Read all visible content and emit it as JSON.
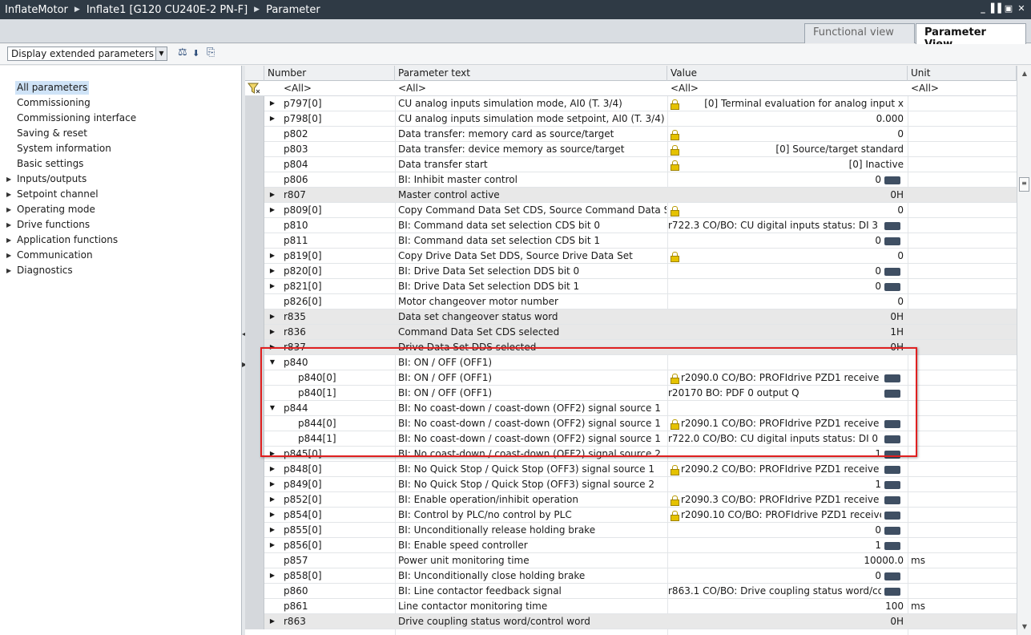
{
  "titlebar": {
    "crumbs": [
      "InflateMotor",
      "Inflate1 [G120 CU240E-2 PN-F]",
      "Parameter"
    ]
  },
  "tabs": {
    "functional": "Functional view",
    "parameter": "Parameter View"
  },
  "toolbar": {
    "filter_select": "Display extended parameters"
  },
  "nav": {
    "items": [
      {
        "label": "All parameters",
        "expandable": false
      },
      {
        "label": "Commissioning",
        "expandable": false
      },
      {
        "label": "Commissioning interface",
        "expandable": false
      },
      {
        "label": "Saving & reset",
        "expandable": false
      },
      {
        "label": "System information",
        "expandable": false
      },
      {
        "label": "Basic settings",
        "expandable": false
      },
      {
        "label": "Inputs/outputs",
        "expandable": true
      },
      {
        "label": "Setpoint channel",
        "expandable": true
      },
      {
        "label": "Operating mode",
        "expandable": true
      },
      {
        "label": "Drive functions",
        "expandable": true
      },
      {
        "label": "Application functions",
        "expandable": true
      },
      {
        "label": "Communication",
        "expandable": true
      },
      {
        "label": "Diagnostics",
        "expandable": true
      }
    ]
  },
  "grid": {
    "columns": {
      "number": "Number",
      "text": "Parameter text",
      "value": "Value",
      "unit": "Unit"
    },
    "filter": {
      "number": "<All>",
      "text": "<All>",
      "value": "<All>",
      "unit": "<All>"
    },
    "rows": [
      {
        "exp": "right",
        "num": "p797[0]",
        "text": "CU analog inputs simulation mode, AI0 (T. 3/4)",
        "lock": true,
        "val": "[0] Terminal evaluation for analog input x",
        "bi": false,
        "unit": "",
        "shaded": false,
        "child": false
      },
      {
        "exp": "right",
        "num": "p798[0]",
        "text": "CU analog inputs simulation mode setpoint, AI0 (T. 3/4)",
        "lock": false,
        "val": "0.000",
        "bi": false,
        "unit": "",
        "shaded": false,
        "child": false
      },
      {
        "exp": "",
        "num": "p802",
        "text": "Data transfer: memory card as source/target",
        "lock": true,
        "val": "0",
        "bi": false,
        "unit": "",
        "shaded": false,
        "child": false
      },
      {
        "exp": "",
        "num": "p803",
        "text": "Data transfer: device memory as source/target",
        "lock": true,
        "val": "[0] Source/target standard",
        "bi": false,
        "unit": "",
        "shaded": false,
        "child": false
      },
      {
        "exp": "",
        "num": "p804",
        "text": "Data transfer start",
        "lock": true,
        "val": "[0] Inactive",
        "bi": false,
        "unit": "",
        "shaded": false,
        "child": false
      },
      {
        "exp": "",
        "num": "p806",
        "text": "BI: Inhibit master control",
        "lock": false,
        "val": "0",
        "bi": true,
        "unit": "",
        "shaded": false,
        "child": false
      },
      {
        "exp": "right",
        "num": "r807",
        "text": "Master control active",
        "lock": false,
        "val": "0H",
        "bi": false,
        "unit": "",
        "shaded": true,
        "child": false
      },
      {
        "exp": "right",
        "num": "p809[0]",
        "text": "Copy Command Data Set CDS, Source Command Data Set",
        "lock": true,
        "val": "0",
        "bi": false,
        "unit": "",
        "shaded": false,
        "child": false
      },
      {
        "exp": "",
        "num": "p810",
        "text": "BI: Command data set selection CDS bit 0",
        "lock": false,
        "val": "r722.3 CO/BO: CU digital inputs status: DI 3 (T. 8)",
        "bi": true,
        "unit": "",
        "shaded": false,
        "child": false
      },
      {
        "exp": "",
        "num": "p811",
        "text": "BI: Command data set selection CDS bit 1",
        "lock": false,
        "val": "0",
        "bi": true,
        "unit": "",
        "shaded": false,
        "child": false
      },
      {
        "exp": "right",
        "num": "p819[0]",
        "text": "Copy Drive Data Set DDS, Source Drive Data Set",
        "lock": true,
        "val": "0",
        "bi": false,
        "unit": "",
        "shaded": false,
        "child": false
      },
      {
        "exp": "right",
        "num": "p820[0]",
        "text": "BI: Drive Data Set selection DDS bit 0",
        "lock": false,
        "val": "0",
        "bi": true,
        "unit": "",
        "shaded": false,
        "child": false
      },
      {
        "exp": "right",
        "num": "p821[0]",
        "text": "BI: Drive Data Set selection DDS bit 1",
        "lock": false,
        "val": "0",
        "bi": true,
        "unit": "",
        "shaded": false,
        "child": false
      },
      {
        "exp": "",
        "num": "p826[0]",
        "text": "Motor changeover motor number",
        "lock": false,
        "val": "0",
        "bi": false,
        "unit": "",
        "shaded": false,
        "child": false
      },
      {
        "exp": "right",
        "num": "r835",
        "text": "Data set changeover status word",
        "lock": false,
        "val": "0H",
        "bi": false,
        "unit": "",
        "shaded": true,
        "child": false
      },
      {
        "exp": "right",
        "num": "r836",
        "text": "Command Data Set CDS selected",
        "lock": false,
        "val": "1H",
        "bi": false,
        "unit": "",
        "shaded": true,
        "child": false
      },
      {
        "exp": "right",
        "num": "r837",
        "text": "Drive Data Set DDS selected",
        "lock": false,
        "val": "0H",
        "bi": false,
        "unit": "",
        "shaded": true,
        "child": false
      },
      {
        "exp": "down",
        "num": "p840",
        "text": "BI: ON / OFF (OFF1)",
        "lock": false,
        "val": "",
        "bi": false,
        "unit": "",
        "shaded": false,
        "child": false
      },
      {
        "exp": "",
        "num": "p840[0]",
        "text": "BI: ON / OFF (OFF1)",
        "lock": true,
        "val": "r2090.0 CO/BO: PROFIdrive PZD1 receive bit-...",
        "bi": true,
        "unit": "",
        "shaded": false,
        "child": true
      },
      {
        "exp": "",
        "num": "p840[1]",
        "text": "BI: ON / OFF (OFF1)",
        "lock": false,
        "val": "r20170 BO: PDF 0 output Q",
        "bi": true,
        "unit": "",
        "shaded": false,
        "child": true
      },
      {
        "exp": "down",
        "num": "p844",
        "text": "BI: No coast-down / coast-down (OFF2) signal source 1",
        "lock": false,
        "val": "",
        "bi": false,
        "unit": "",
        "shaded": false,
        "child": false
      },
      {
        "exp": "",
        "num": "p844[0]",
        "text": "BI: No coast-down / coast-down (OFF2) signal source 1",
        "lock": true,
        "val": "r2090.1 CO/BO: PROFIdrive PZD1 receive bit-...",
        "bi": true,
        "unit": "",
        "shaded": false,
        "child": true
      },
      {
        "exp": "",
        "num": "p844[1]",
        "text": "BI: No coast-down / coast-down (OFF2) signal source 1",
        "lock": false,
        "val": "r722.0 CO/BO: CU digital inputs status: DI 0 (T. 5)",
        "bi": true,
        "unit": "",
        "shaded": false,
        "child": true
      },
      {
        "exp": "right",
        "num": "p845[0]",
        "text": "BI: No coast-down / coast-down (OFF2) signal source 2",
        "lock": false,
        "val": "1",
        "bi": true,
        "unit": "",
        "shaded": false,
        "child": false
      },
      {
        "exp": "right",
        "num": "p848[0]",
        "text": "BI: No Quick Stop / Quick Stop (OFF3) signal source 1",
        "lock": true,
        "val": "r2090.2 CO/BO: PROFIdrive PZD1 receive bit-...",
        "bi": true,
        "unit": "",
        "shaded": false,
        "child": false
      },
      {
        "exp": "right",
        "num": "p849[0]",
        "text": "BI: No Quick Stop / Quick Stop (OFF3) signal source 2",
        "lock": false,
        "val": "1",
        "bi": true,
        "unit": "",
        "shaded": false,
        "child": false
      },
      {
        "exp": "right",
        "num": "p852[0]",
        "text": "BI: Enable operation/inhibit operation",
        "lock": true,
        "val": "r2090.3 CO/BO: PROFIdrive PZD1 receive bit-...",
        "bi": true,
        "unit": "",
        "shaded": false,
        "child": false
      },
      {
        "exp": "right",
        "num": "p854[0]",
        "text": "BI: Control by PLC/no control by PLC",
        "lock": true,
        "val": "r2090.10 CO/BO: PROFIdrive PZD1 receive bi...",
        "bi": true,
        "unit": "",
        "shaded": false,
        "child": false
      },
      {
        "exp": "right",
        "num": "p855[0]",
        "text": "BI: Unconditionally release holding brake",
        "lock": false,
        "val": "0",
        "bi": true,
        "unit": "",
        "shaded": false,
        "child": false
      },
      {
        "exp": "right",
        "num": "p856[0]",
        "text": "BI: Enable speed controller",
        "lock": false,
        "val": "1",
        "bi": true,
        "unit": "",
        "shaded": false,
        "child": false
      },
      {
        "exp": "",
        "num": "p857",
        "text": "Power unit monitoring time",
        "lock": false,
        "val": "10000.0",
        "bi": false,
        "unit": "ms",
        "shaded": false,
        "child": false
      },
      {
        "exp": "right",
        "num": "p858[0]",
        "text": "BI: Unconditionally close holding brake",
        "lock": false,
        "val": "0",
        "bi": true,
        "unit": "",
        "shaded": false,
        "child": false
      },
      {
        "exp": "",
        "num": "p860",
        "text": "BI: Line contactor feedback signal",
        "lock": false,
        "val": "r863.1 CO/BO: Drive coupling status word/contr...",
        "bi": true,
        "unit": "",
        "shaded": false,
        "child": false
      },
      {
        "exp": "",
        "num": "p861",
        "text": "Line contactor monitoring time",
        "lock": false,
        "val": "100",
        "bi": false,
        "unit": "ms",
        "shaded": false,
        "child": false
      },
      {
        "exp": "right",
        "num": "r863",
        "text": "Drive coupling status word/control word",
        "lock": false,
        "val": "0H",
        "bi": false,
        "unit": "",
        "shaded": true,
        "child": false
      }
    ]
  },
  "colors": {
    "titlebar": "#2f3a45",
    "highlight": "#e02020",
    "lock": "#e5c200",
    "bi_connector": "#3f4f63"
  }
}
